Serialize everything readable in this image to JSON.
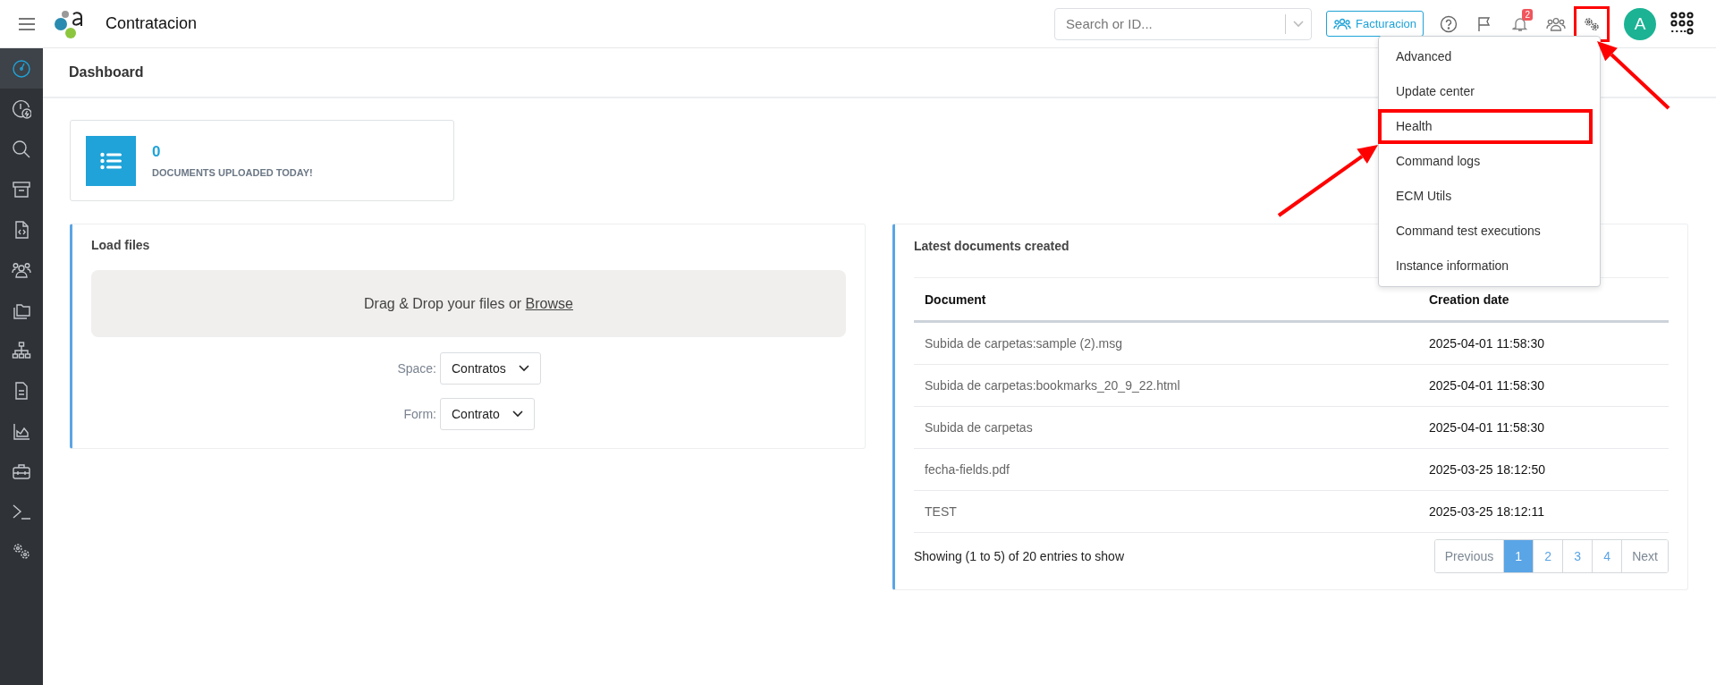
{
  "header": {
    "app_title": "Contratacion",
    "search": {
      "placeholder": "Search or ID..."
    },
    "space_button": "Facturacion",
    "notification_count": "2",
    "settings_button": {
      "annotated": true
    },
    "avatar_initial": "A"
  },
  "sidebar": {
    "items": [
      {
        "selected": true
      },
      {
        "selected": false
      },
      {
        "selected": false
      },
      {
        "selected": false
      },
      {
        "selected": false
      },
      {
        "selected": false
      },
      {
        "selected": false
      },
      {
        "selected": false
      },
      {
        "selected": false
      },
      {
        "selected": false
      },
      {
        "selected": false
      },
      {
        "selected": false
      },
      {
        "selected": false
      }
    ]
  },
  "page_title": "Dashboard",
  "stat_card": {
    "value": "0",
    "label": "DOCUMENTS UPLOADED TODAY!"
  },
  "load_files": {
    "title": "Load files",
    "dropzone_text": "Drag & Drop your files or",
    "browse_link": "Browse",
    "fields": [
      {
        "label": "Space:",
        "value": "Contratos"
      },
      {
        "label": "Form:",
        "value": "Contrato"
      }
    ]
  },
  "latest_documents": {
    "title": "Latest documents created",
    "table": {
      "columns": [
        "Document",
        "Creation date"
      ],
      "rows": [
        [
          "Subida de carpetas:sample (2).msg",
          "2025-04-01 11:58:30"
        ],
        [
          "Subida de carpetas:bookmarks_20_9_22.html",
          "2025-04-01 11:58:30"
        ],
        [
          "Subida de carpetas",
          "2025-04-01 11:58:30"
        ],
        [
          "fecha-fields.pdf",
          "2025-03-25 18:12:50"
        ],
        [
          "TEST",
          "2025-03-25 18:12:11"
        ]
      ]
    },
    "summary": "Showing (1 to 5) of 20 entries to show",
    "pagination": [
      {
        "label": "Previous",
        "selected": false
      },
      {
        "label": "1",
        "selected": true
      },
      {
        "label": "2",
        "selected": false
      },
      {
        "label": "3",
        "selected": false
      },
      {
        "label": "4",
        "selected": false
      },
      {
        "label": "Next",
        "selected": false
      }
    ]
  },
  "settings_menu": {
    "items": [
      {
        "label": "Advanced",
        "annotated": false
      },
      {
        "label": "Update center",
        "annotated": false
      },
      {
        "label": "Health",
        "annotated": true
      },
      {
        "label": "Command logs",
        "annotated": false
      },
      {
        "label": "ECM Utils",
        "annotated": false
      },
      {
        "label": "Command test executions",
        "annotated": false
      },
      {
        "label": "Instance information",
        "annotated": false
      }
    ]
  }
}
